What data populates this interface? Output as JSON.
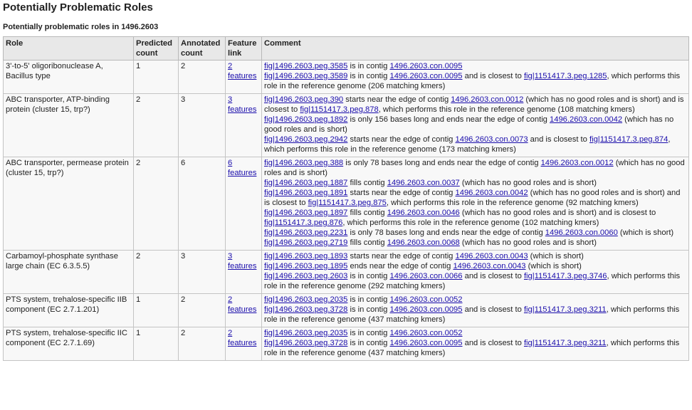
{
  "page_title": "Potentially Problematic Roles",
  "subtitle": "Potentially problematic roles in 1496.2603",
  "headers": {
    "role": "Role",
    "predicted": "Predicted count",
    "annotated": "Annotated count",
    "feature_link": "Feature link",
    "comment": "Comment"
  },
  "rows": [
    {
      "role": "3'-to-5' oligoribonuclease A, Bacillus type",
      "predicted": "1",
      "annotated": "2",
      "features_label": "2 features",
      "comments": [
        [
          {
            "link": "fig|1496.2603.peg.3585"
          },
          {
            "text": " is in contig "
          },
          {
            "link": "1496.2603.con.0095"
          }
        ],
        [
          {
            "link": "fig|1496.2603.peg.3589"
          },
          {
            "text": " is in contig "
          },
          {
            "link": "1496.2603.con.0095"
          },
          {
            "text": " and is closest to "
          },
          {
            "link": "fig|1151417.3.peg.1285"
          },
          {
            "text": ", which performs this role in the reference genome (206 matching kmers)"
          }
        ]
      ]
    },
    {
      "role": "ABC transporter, ATP-binding protein (cluster 15, trp?)",
      "predicted": "2",
      "annotated": "3",
      "features_label": "3 features",
      "comments": [
        [
          {
            "link": "fig|1496.2603.peg.390"
          },
          {
            "text": " starts near the edge of contig "
          },
          {
            "link": "1496.2603.con.0012"
          },
          {
            "text": " (which has no good roles and is short) and is closest to "
          },
          {
            "link": "fig|1151417.3.peg.878"
          },
          {
            "text": ", which performs this role in the reference genome (108 matching kmers)"
          }
        ],
        [
          {
            "link": "fig|1496.2603.peg.1892"
          },
          {
            "text": " is only 156 bases long and ends near the edge of contig "
          },
          {
            "link": "1496.2603.con.0042"
          },
          {
            "text": " (which has no good roles and is short)"
          }
        ],
        [
          {
            "link": "fig|1496.2603.peg.2942"
          },
          {
            "text": " starts near the edge of contig "
          },
          {
            "link": "1496.2603.con.0073"
          },
          {
            "text": " and is closest to "
          },
          {
            "link": "fig|1151417.3.peg.874"
          },
          {
            "text": ", which performs this role in the reference genome (173 matching kmers)"
          }
        ]
      ]
    },
    {
      "role": "ABC transporter, permease protein (cluster 15, trp?)",
      "predicted": "2",
      "annotated": "6",
      "features_label": "6 features",
      "comments": [
        [
          {
            "link": "fig|1496.2603.peg.388"
          },
          {
            "text": " is only 78 bases long and ends near the edge of contig "
          },
          {
            "link": "1496.2603.con.0012"
          },
          {
            "text": " (which has no good roles and is short)"
          }
        ],
        [
          {
            "link": "fig|1496.2603.peg.1887"
          },
          {
            "text": " fills contig "
          },
          {
            "link": "1496.2603.con.0037"
          },
          {
            "text": " (which has no good roles and is short)"
          }
        ],
        [
          {
            "link": "fig|1496.2603.peg.1891"
          },
          {
            "text": " starts near the edge of contig "
          },
          {
            "link": "1496.2603.con.0042"
          },
          {
            "text": " (which has no good roles and is short) and is closest to "
          },
          {
            "link": "fig|1151417.3.peg.875"
          },
          {
            "text": ", which performs this role in the reference genome (92 matching kmers)"
          }
        ],
        [
          {
            "link": "fig|1496.2603.peg.1897"
          },
          {
            "text": " fills contig "
          },
          {
            "link": "1496.2603.con.0046"
          },
          {
            "text": " (which has no good roles and is short) and is closest to "
          },
          {
            "link": "fig|1151417.3.peg.876"
          },
          {
            "text": ", which performs this role in the reference genome (102 matching kmers)"
          }
        ],
        [
          {
            "link": "fig|1496.2603.peg.2231"
          },
          {
            "text": " is only 78 bases long and ends near the edge of contig "
          },
          {
            "link": "1496.2603.con.0060"
          },
          {
            "text": " (which is short)"
          }
        ],
        [
          {
            "link": "fig|1496.2603.peg.2719"
          },
          {
            "text": " fills contig "
          },
          {
            "link": "1496.2603.con.0068"
          },
          {
            "text": " (which has no good roles and is short)"
          }
        ]
      ]
    },
    {
      "role": "Carbamoyl-phosphate synthase large chain (EC 6.3.5.5)",
      "predicted": "2",
      "annotated": "3",
      "features_label": "3 features",
      "comments": [
        [
          {
            "link": "fig|1496.2603.peg.1893"
          },
          {
            "text": " starts near the edge of contig "
          },
          {
            "link": "1496.2603.con.0043"
          },
          {
            "text": " (which is short)"
          }
        ],
        [
          {
            "link": "fig|1496.2603.peg.1895"
          },
          {
            "text": " ends near the edge of contig "
          },
          {
            "link": "1496.2603.con.0043"
          },
          {
            "text": " (which is short)"
          }
        ],
        [
          {
            "link": "fig|1496.2603.peg.2603"
          },
          {
            "text": " is in contig "
          },
          {
            "link": "1496.2603.con.0066"
          },
          {
            "text": " and is closest to "
          },
          {
            "link": "fig|1151417.3.peg.3746"
          },
          {
            "text": ", which performs this role in the reference genome (292 matching kmers)"
          }
        ]
      ]
    },
    {
      "role": "PTS system, trehalose-specific IIB component (EC 2.7.1.201)",
      "predicted": "1",
      "annotated": "2",
      "features_label": "2 features",
      "comments": [
        [
          {
            "link": "fig|1496.2603.peg.2035"
          },
          {
            "text": " is in contig "
          },
          {
            "link": "1496.2603.con.0052"
          }
        ],
        [
          {
            "link": "fig|1496.2603.peg.3728"
          },
          {
            "text": " is in contig "
          },
          {
            "link": "1496.2603.con.0095"
          },
          {
            "text": " and is closest to "
          },
          {
            "link": "fig|1151417.3.peg.3211"
          },
          {
            "text": ", which performs this role in the reference genome (437 matching kmers)"
          }
        ]
      ]
    },
    {
      "role": "PTS system, trehalose-specific IIC component (EC 2.7.1.69)",
      "predicted": "1",
      "annotated": "2",
      "features_label": "2 features",
      "comments": [
        [
          {
            "link": "fig|1496.2603.peg.2035"
          },
          {
            "text": " is in contig "
          },
          {
            "link": "1496.2603.con.0052"
          }
        ],
        [
          {
            "link": "fig|1496.2603.peg.3728"
          },
          {
            "text": " is in contig "
          },
          {
            "link": "1496.2603.con.0095"
          },
          {
            "text": " and is closest to "
          },
          {
            "link": "fig|1151417.3.peg.3211"
          },
          {
            "text": ", which performs this role in the reference genome (437 matching kmers)"
          }
        ]
      ]
    }
  ]
}
